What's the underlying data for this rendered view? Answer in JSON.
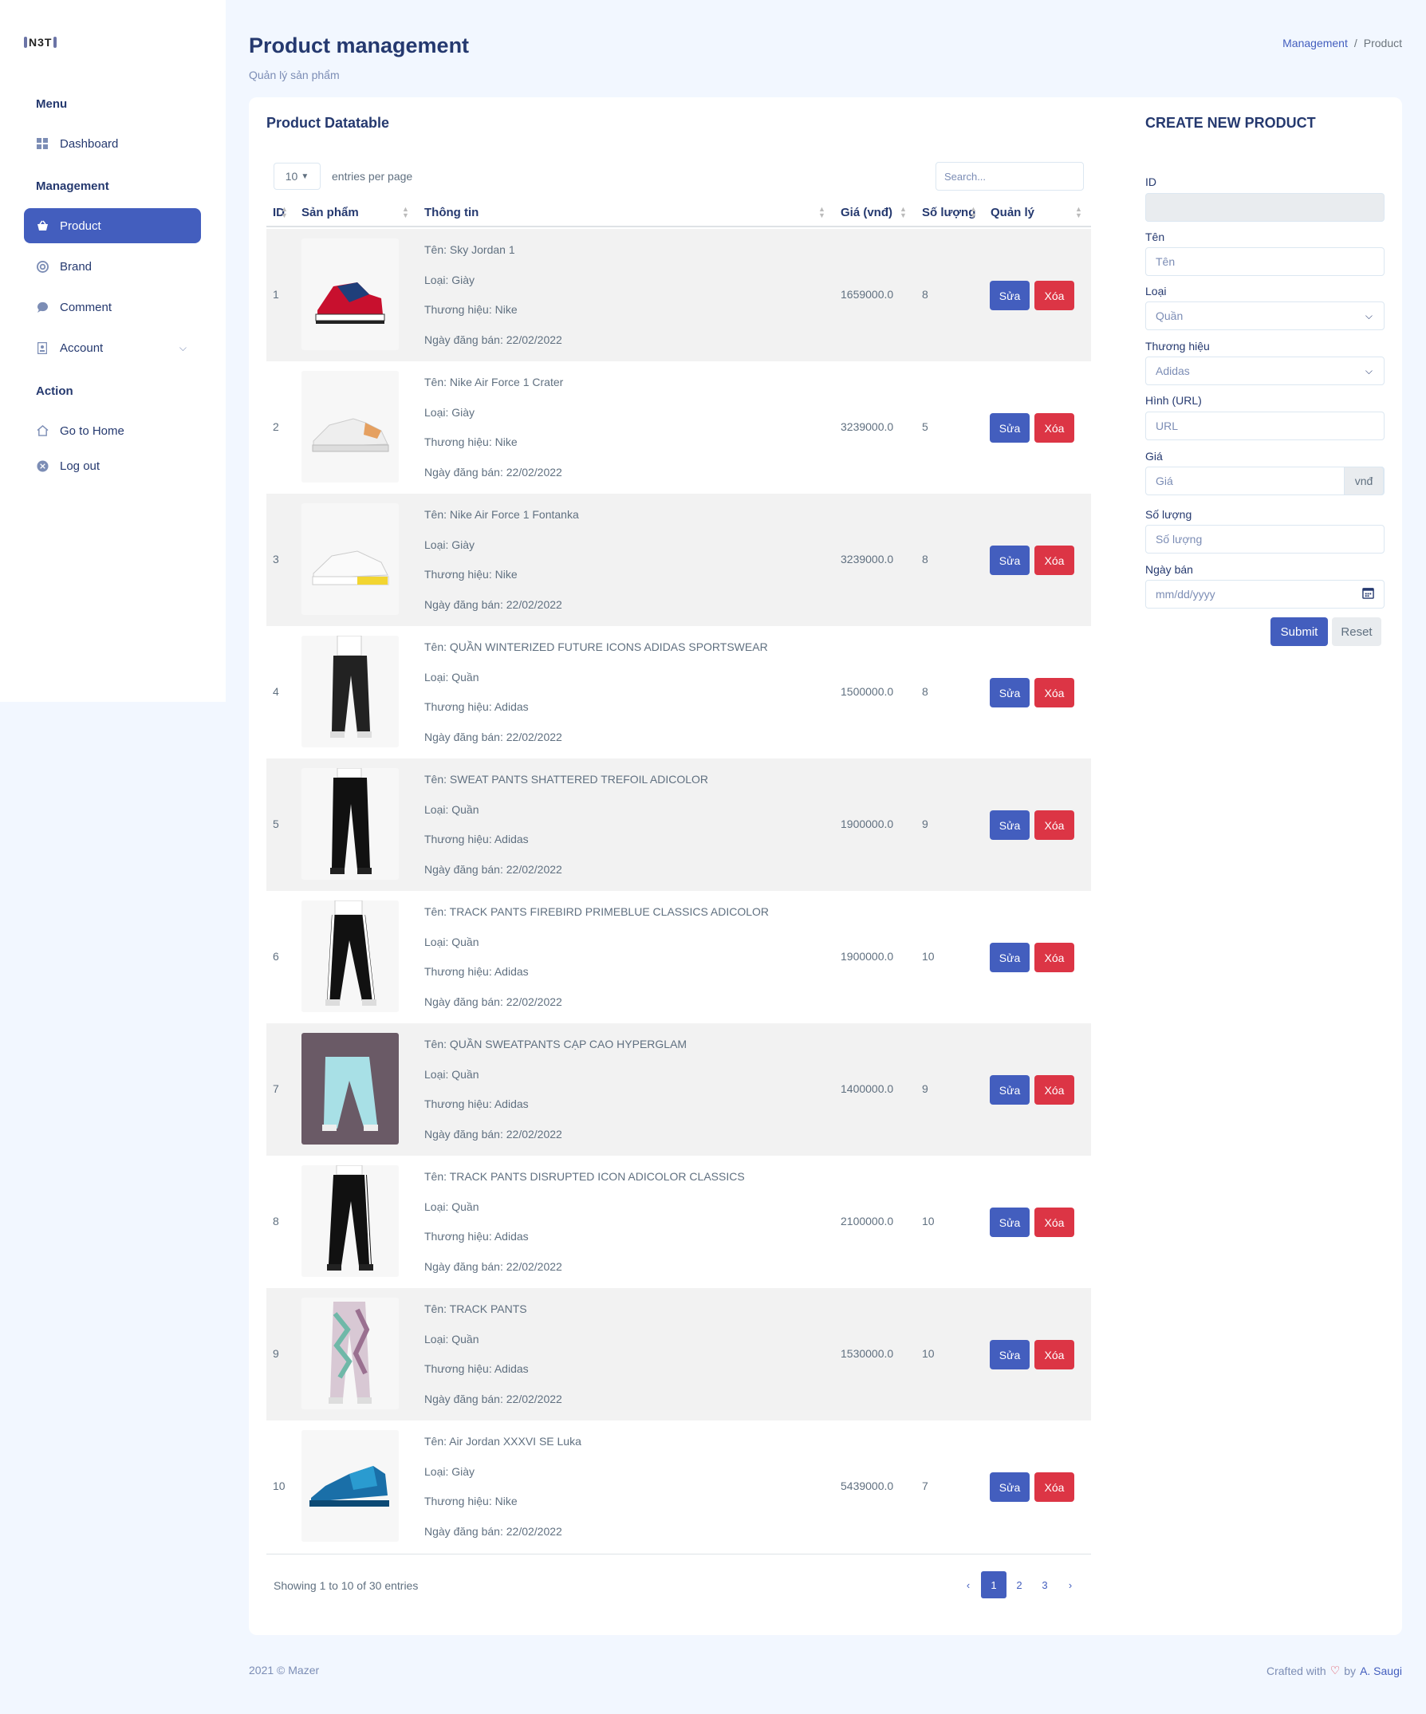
{
  "sidebar": {
    "logo": "N3T",
    "menu_title": "Menu",
    "dashboard": "Dashboard",
    "management_title": "Management",
    "product": "Product",
    "brand": "Brand",
    "comment": "Comment",
    "account": "Account",
    "action_title": "Action",
    "go_home": "Go to Home",
    "logout": "Log out"
  },
  "header": {
    "title": "Product management",
    "subtitle": "Quản lý sản phẩm",
    "breadcrumb": [
      "Management",
      "Product"
    ]
  },
  "table": {
    "title": "Product Datatable",
    "entries_value": "10",
    "entries_label": "entries per page",
    "search_placeholder": "Search...",
    "columns": [
      "ID",
      "Sản phẩm",
      "Thông tin",
      "Giá (vnđ)",
      "Số lượng",
      "Quản lý"
    ],
    "edit_label": "Sửa",
    "delete_label": "Xóa",
    "rows": [
      {
        "id": "1",
        "name": "Tên: Sky Jordan 1",
        "type": "Loại: Giày",
        "brand": "Thương hiệu: Nike",
        "date": "Ngày đăng bán: 22/02/2022",
        "price": "1659000.0",
        "qty": "8"
      },
      {
        "id": "2",
        "name": "Tên: Nike Air Force 1 Crater",
        "type": "Loại: Giày",
        "brand": "Thương hiệu: Nike",
        "date": "Ngày đăng bán: 22/02/2022",
        "price": "3239000.0",
        "qty": "5"
      },
      {
        "id": "3",
        "name": "Tên: Nike Air Force 1 Fontanka",
        "type": "Loại: Giày",
        "brand": "Thương hiệu: Nike",
        "date": "Ngày đăng bán: 22/02/2022",
        "price": "3239000.0",
        "qty": "8"
      },
      {
        "id": "4",
        "name": "Tên: QUẦN WINTERIZED FUTURE ICONS ADIDAS SPORTSWEAR",
        "type": "Loại: Quần",
        "brand": "Thương hiệu: Adidas",
        "date": "Ngày đăng bán: 22/02/2022",
        "price": "1500000.0",
        "qty": "8"
      },
      {
        "id": "5",
        "name": "Tên: SWEAT PANTS SHATTERED TREFOIL ADICOLOR",
        "type": "Loại: Quần",
        "brand": "Thương hiệu: Adidas",
        "date": "Ngày đăng bán: 22/02/2022",
        "price": "1900000.0",
        "qty": "9"
      },
      {
        "id": "6",
        "name": "Tên: TRACK PANTS FIREBIRD PRIMEBLUE CLASSICS ADICOLOR",
        "type": "Loại: Quần",
        "brand": "Thương hiệu: Adidas",
        "date": "Ngày đăng bán: 22/02/2022",
        "price": "1900000.0",
        "qty": "10"
      },
      {
        "id": "7",
        "name": "Tên: QUẦN SWEATPANTS CẠP CAO HYPERGLAM",
        "type": "Loại: Quần",
        "brand": "Thương hiệu: Adidas",
        "date": "Ngày đăng bán: 22/02/2022",
        "price": "1400000.0",
        "qty": "9"
      },
      {
        "id": "8",
        "name": "Tên: TRACK PANTS DISRUPTED ICON ADICOLOR CLASSICS",
        "type": "Loại: Quần",
        "brand": "Thương hiệu: Adidas",
        "date": "Ngày đăng bán: 22/02/2022",
        "price": "2100000.0",
        "qty": "10"
      },
      {
        "id": "9",
        "name": "Tên: TRACK PANTS",
        "type": "Loại: Quần",
        "brand": "Thương hiệu: Adidas",
        "date": "Ngày đăng bán: 22/02/2022",
        "price": "1530000.0",
        "qty": "10"
      },
      {
        "id": "10",
        "name": "Tên: Air Jordan XXXVI SE Luka",
        "type": "Loại: Giày",
        "brand": "Thương hiệu: Nike",
        "date": "Ngày đăng bán: 22/02/2022",
        "price": "5439000.0",
        "qty": "7"
      }
    ],
    "showing": "Showing 1 to 10 of 30 entries",
    "pages": [
      "‹",
      "1",
      "2",
      "3",
      "›"
    ]
  },
  "form": {
    "title": "CREATE NEW PRODUCT",
    "id_label": "ID",
    "name_label": "Tên",
    "name_placeholder": "Tên",
    "type_label": "Loại",
    "type_value": "Quần",
    "brand_label": "Thương hiệu",
    "brand_value": "Adidas",
    "image_label": "Hình (URL)",
    "image_placeholder": "URL",
    "price_label": "Giá",
    "price_placeholder": "Giá",
    "price_unit": "vnđ",
    "qty_label": "Số lượng",
    "qty_placeholder": "Số lượng",
    "date_label": "Ngày bán",
    "date_placeholder": "mm/dd/yyyy",
    "submit": "Submit",
    "reset": "Reset"
  },
  "footer": {
    "left": "2021 © Mazer",
    "crafted": "Crafted with",
    "by": "by",
    "author": "A. Saugi"
  }
}
